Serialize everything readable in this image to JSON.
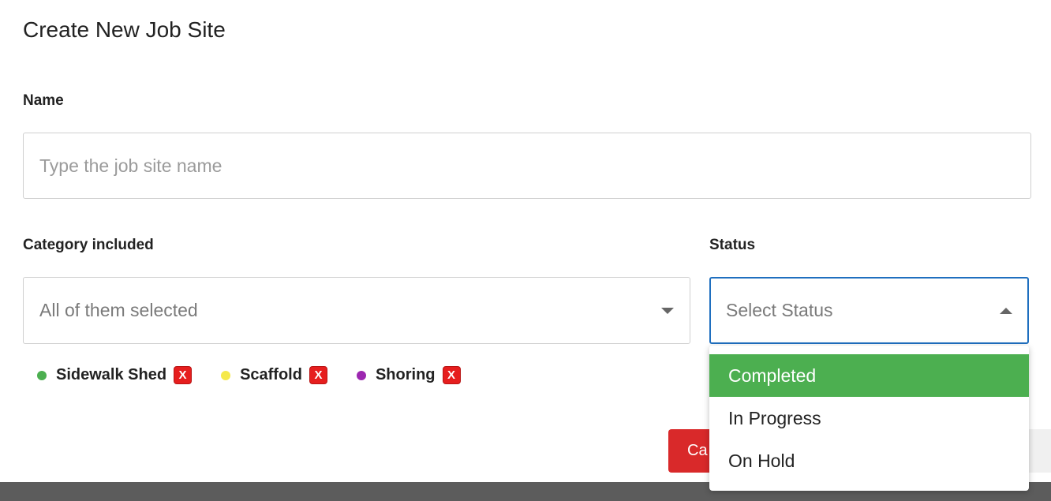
{
  "dialog": {
    "title": "Create New Job Site"
  },
  "name_field": {
    "label": "Name",
    "placeholder": "Type the job site name",
    "value": ""
  },
  "category_field": {
    "label": "Category included",
    "value": "All of them selected",
    "chips": [
      {
        "label": "Sidewalk Shed",
        "color": "#4caf50",
        "remove_label": "X"
      },
      {
        "label": "Scaffold",
        "color": "#f5e94a",
        "remove_label": "X"
      },
      {
        "label": "Shoring",
        "color": "#9c27b0",
        "remove_label": "X"
      }
    ]
  },
  "status_field": {
    "label": "Status",
    "placeholder": "Select Status",
    "options": [
      {
        "label": "Completed",
        "highlighted": true
      },
      {
        "label": "In Progress",
        "highlighted": false
      },
      {
        "label": "On Hold",
        "highlighted": false
      }
    ]
  },
  "actions": {
    "cancel_label": "Ca"
  },
  "colors": {
    "accent_focus": "#1f6fbf",
    "option_highlight": "#4caf50",
    "cancel_button": "#d9292a",
    "remove_chip": "#e61e1e"
  }
}
